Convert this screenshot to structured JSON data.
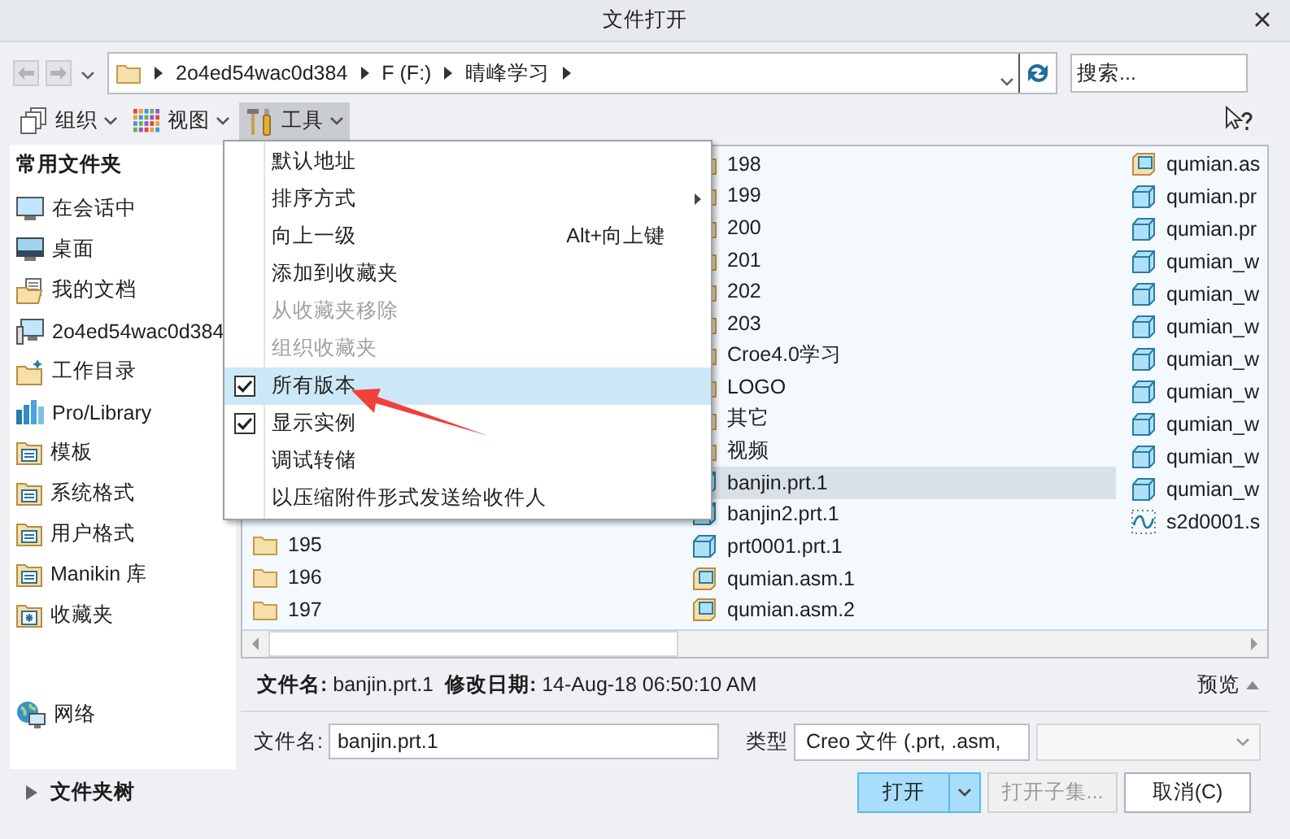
{
  "window": {
    "title": "文件打开"
  },
  "address": {
    "path": [
      "2o4ed54wac0d384",
      "F (F:)",
      "晴峰学习"
    ]
  },
  "search": {
    "placeholder": "搜索..."
  },
  "toolbar": [
    {
      "label": "组织",
      "kind": "organize",
      "selected": false
    },
    {
      "label": "视图",
      "kind": "view",
      "selected": false
    },
    {
      "label": "工具",
      "kind": "tools",
      "selected": true
    }
  ],
  "sidebar": {
    "title": "常用文件夹",
    "items": [
      {
        "label": "在会话中",
        "kind": "monitor"
      },
      {
        "label": "桌面",
        "kind": "desktop"
      },
      {
        "label": "我的文档",
        "kind": "documents"
      },
      {
        "label": "2o4ed54wac0d384",
        "kind": "computer"
      },
      {
        "label": "工作目录",
        "kind": "workdir"
      },
      {
        "label": "Pro/Library",
        "kind": "library"
      },
      {
        "label": "模板",
        "kind": "list"
      },
      {
        "label": "系统格式",
        "kind": "list"
      },
      {
        "label": "用户格式",
        "kind": "list"
      },
      {
        "label": "Manikin 库",
        "kind": "list"
      },
      {
        "label": "收藏夹",
        "kind": "favorites"
      }
    ],
    "network": {
      "label": "网络"
    }
  },
  "menu": {
    "items": [
      {
        "label": "默认地址",
        "kind": "plain",
        "disabled": false,
        "selected": false
      },
      {
        "label": "排序方式",
        "kind": "submenu",
        "disabled": false,
        "selected": false
      },
      {
        "label": "向上一级",
        "kind": "plain",
        "shortcut": "Alt+向上键",
        "disabled": false,
        "selected": false
      },
      {
        "label": "添加到收藏夹",
        "kind": "plain",
        "disabled": false,
        "selected": false
      },
      {
        "label": "从收藏夹移除",
        "kind": "plain",
        "disabled": true,
        "selected": false
      },
      {
        "label": "组织收藏夹",
        "kind": "plain",
        "disabled": true,
        "selected": false
      },
      {
        "label": "所有版本",
        "kind": "check",
        "checked": true,
        "disabled": false,
        "selected": true
      },
      {
        "label": "显示实例",
        "kind": "check",
        "checked": true,
        "disabled": false,
        "selected": false
      },
      {
        "label": "调试转储",
        "kind": "plain",
        "disabled": false,
        "selected": false
      },
      {
        "label": "以压缩附件形式发送给收件人",
        "kind": "plain",
        "disabled": false,
        "selected": false
      }
    ]
  },
  "files": {
    "columns": [
      [
        {
          "name": "195",
          "kind": "folder",
          "selected": false
        },
        {
          "name": "196",
          "kind": "folder",
          "selected": false
        },
        {
          "name": "197",
          "kind": "folder",
          "selected": false
        }
      ],
      [
        {
          "name": "198",
          "kind": "folder",
          "selected": false
        },
        {
          "name": "199",
          "kind": "folder",
          "selected": false
        },
        {
          "name": "200",
          "kind": "folder",
          "selected": false
        },
        {
          "name": "201",
          "kind": "folder",
          "selected": false
        },
        {
          "name": "202",
          "kind": "folder",
          "selected": false
        },
        {
          "name": "203",
          "kind": "folder",
          "selected": false
        },
        {
          "name": "Croe4.0学习",
          "kind": "folder",
          "selected": false
        },
        {
          "name": "LOGO",
          "kind": "folder",
          "selected": false
        },
        {
          "name": "其它",
          "kind": "folder",
          "selected": false
        },
        {
          "name": "视频",
          "kind": "folder",
          "selected": false
        },
        {
          "name": "banjin.prt.1",
          "kind": "part",
          "selected": true
        },
        {
          "name": "banjin2.prt.1",
          "kind": "part",
          "selected": false
        },
        {
          "name": "prt0001.prt.1",
          "kind": "part",
          "selected": false
        },
        {
          "name": "qumian.asm.1",
          "kind": "assembly",
          "selected": false
        },
        {
          "name": "qumian.asm.2",
          "kind": "assembly",
          "selected": false
        }
      ],
      [
        {
          "name": "qumian.as",
          "kind": "assembly",
          "selected": false
        },
        {
          "name": "qumian.pr",
          "kind": "part",
          "selected": false
        },
        {
          "name": "qumian.pr",
          "kind": "part",
          "selected": false
        },
        {
          "name": "qumian_w",
          "kind": "part",
          "selected": false
        },
        {
          "name": "qumian_w",
          "kind": "part",
          "selected": false
        },
        {
          "name": "qumian_w",
          "kind": "part",
          "selected": false
        },
        {
          "name": "qumian_w",
          "kind": "part",
          "selected": false
        },
        {
          "name": "qumian_w",
          "kind": "part",
          "selected": false
        },
        {
          "name": "qumian_w",
          "kind": "part",
          "selected": false
        },
        {
          "name": "qumian_w",
          "kind": "part",
          "selected": false
        },
        {
          "name": "qumian_w",
          "kind": "part",
          "selected": false
        },
        {
          "name": "s2d0001.s",
          "kind": "sketch",
          "selected": false
        }
      ]
    ]
  },
  "details": {
    "name_label": "文件名:",
    "name": "banjin.prt.1",
    "date_label": "修改日期:",
    "date": "14-Aug-18 06:50:10 AM",
    "preview": "预览"
  },
  "filename": {
    "label": "文件名:",
    "value": "banjin.prt.1"
  },
  "type": {
    "label": "类型",
    "value": "Creo 文件 (.prt, .asm,"
  },
  "buttons": [
    {
      "label": "打开",
      "kind": "primary"
    },
    {
      "label": "打开子集...",
      "kind": "disabled"
    },
    {
      "label": "取消(C)",
      "kind": "normal"
    }
  ],
  "folder_tree": {
    "label": "文件夹树",
    "expanded": false
  }
}
